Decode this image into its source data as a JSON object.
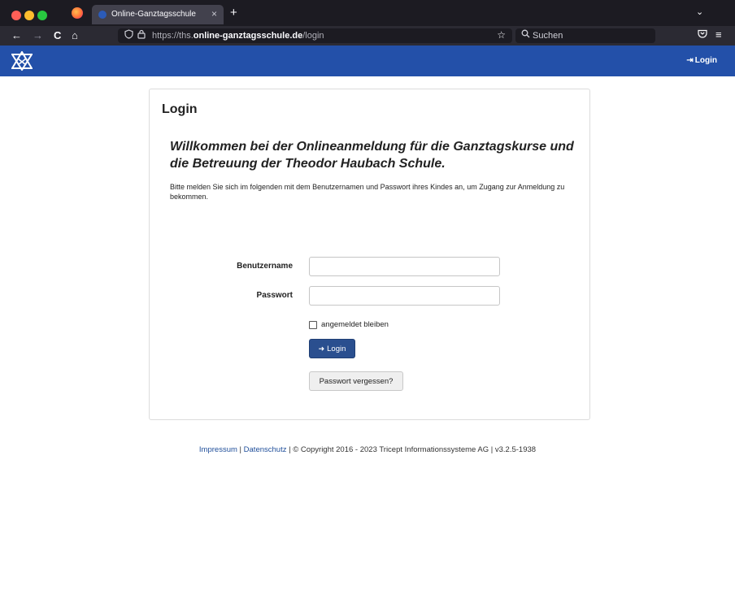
{
  "browser": {
    "tab_title": "Online-Ganztagsschule",
    "tab_close": "×",
    "new_tab": "+",
    "tabs_menu": "⌄",
    "nav": {
      "back": "←",
      "forward": "→",
      "reload": "C",
      "home": "⌂"
    },
    "url_prefix": "https://ths.",
    "url_host": "online-ganztagsschule.de",
    "url_path": "/login",
    "search_placeholder": "Suchen",
    "menu": "≡"
  },
  "header": {
    "login_label": "Login",
    "brand_color": "#2350a9"
  },
  "card": {
    "title": "Login",
    "welcome_line1": "Willkommen bei der Onlineanmeldung für die Ganztagskurse und",
    "welcome_line2": "die Betreuung der Theodor Haubach Schule.",
    "intro": "Bitte melden Sie sich im folgenden mit dem Benutzernamen und Passwort ihres Kindes an, um Zugang zur Anmeldung zu bekommen.",
    "username_label": "Benutzername",
    "username_value": "",
    "password_label": "Passwort",
    "password_value": "",
    "remember_label": "angemeldet bleiben",
    "login_button": "Login",
    "forgot_button": "Passwort vergessen?"
  },
  "footer": {
    "impressum": "Impressum",
    "sep1": " | ",
    "datenschutz": "Datenschutz",
    "copyright": " | © Copyright 2016 - 2023 Tricept Informationssysteme AG | v3.2.5-1938"
  }
}
